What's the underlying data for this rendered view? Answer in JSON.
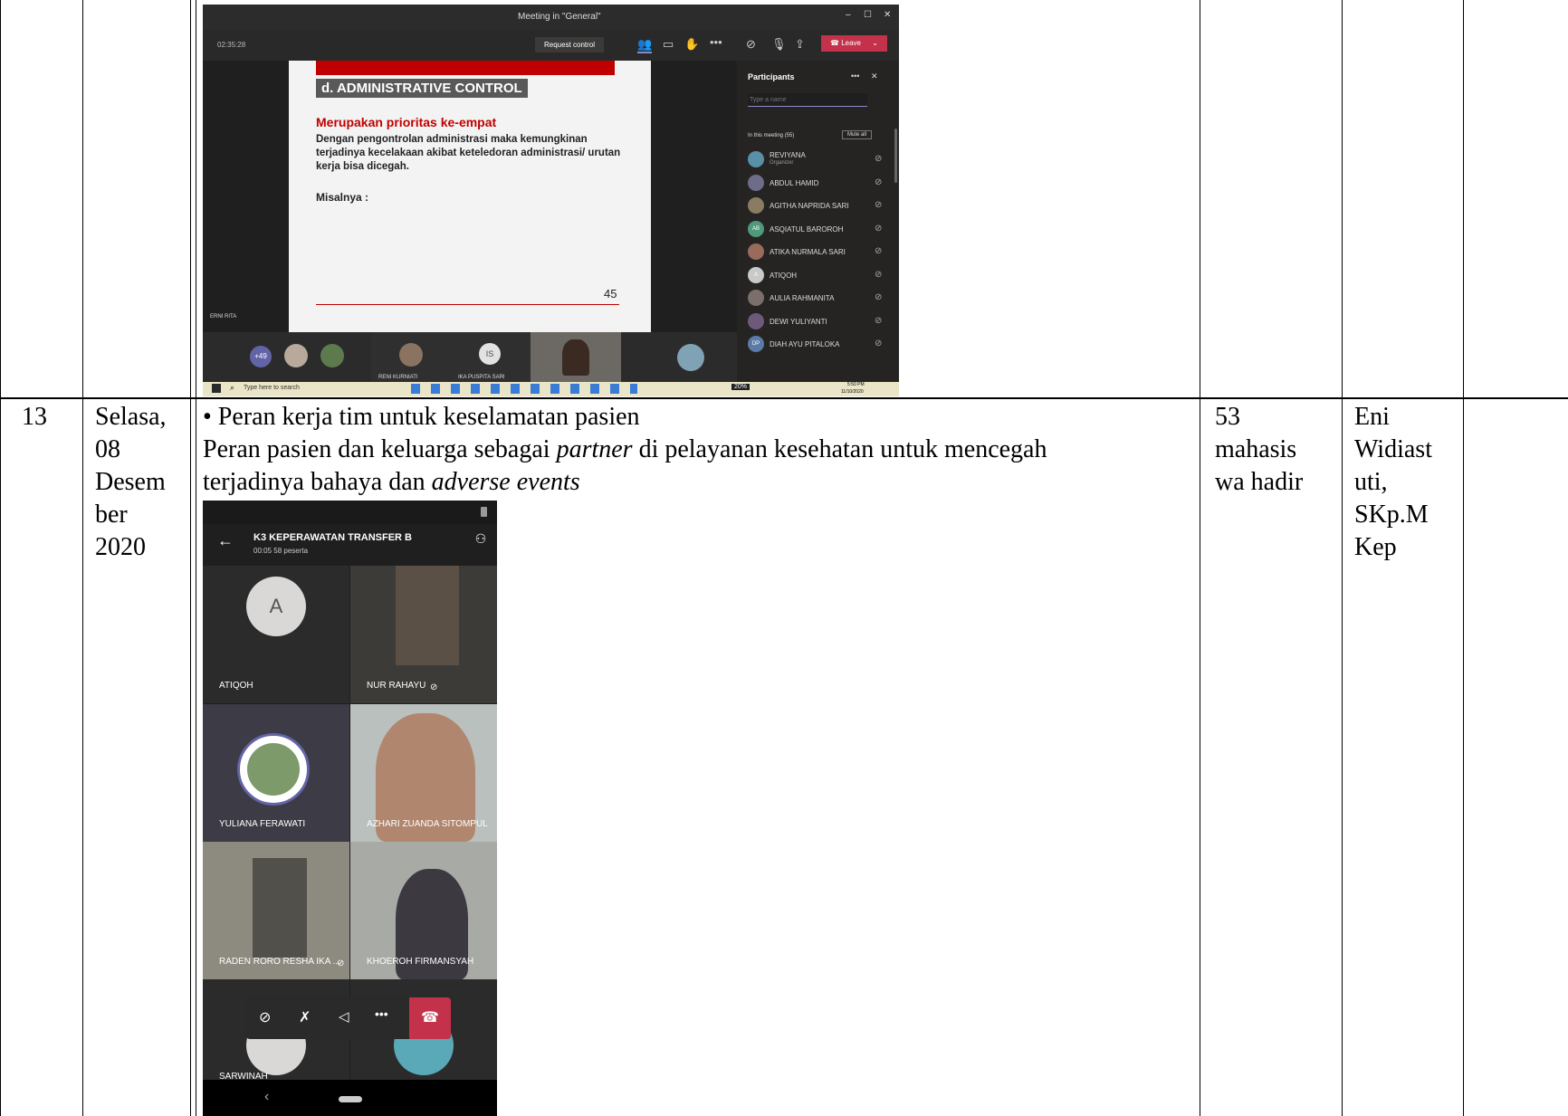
{
  "row_top": {
    "teams": {
      "window_title": "Meeting in \"General\"",
      "timer": "02:35:28",
      "request_control": "Request control",
      "leave": "Leave",
      "slide": {
        "heading": "d. ADMINISTRATIVE CONTROL",
        "subheading": "Merupakan prioritas ke-empat",
        "body": "Dengan pengontrolan administrasi maka kemungkinan terjadinya kecelakaan akibat keteledoran administrasi/ urutan kerja bisa dicegah.",
        "misalnya": "Misalnya :",
        "page_number": "45"
      },
      "presenter": "ERNI RITA",
      "participants": {
        "title": "Participants",
        "search_placeholder": "Type a name",
        "in_meeting": "In this meeting (55)",
        "mute_all": "Mute all",
        "list": [
          {
            "name": "REVIYANA",
            "role": "Organizer",
            "initials": ""
          },
          {
            "name": "ABDUL HAMID",
            "role": "",
            "initials": ""
          },
          {
            "name": "AGITHA NAPRIDA SARI",
            "role": "",
            "initials": ""
          },
          {
            "name": "ASQIATUL BAROROH",
            "role": "",
            "initials": "AB"
          },
          {
            "name": "ATIKA NURMALA SARI",
            "role": "",
            "initials": ""
          },
          {
            "name": "ATIQOH",
            "role": "",
            "initials": "A"
          },
          {
            "name": "AULIA RAHMANITA",
            "role": "",
            "initials": ""
          },
          {
            "name": "DEWI YULIYANTI",
            "role": "",
            "initials": ""
          },
          {
            "name": "DIAH AYU PITALOKA",
            "role": "",
            "initials": "DP"
          }
        ]
      },
      "strip": {
        "more_count": "+49",
        "names": [
          "RENI KURNIATI",
          "IKA PUSPITA SARI",
          "IS"
        ]
      },
      "taskbar": {
        "search": "Type here to search",
        "time": "5:50 PM",
        "date": "11/10/2020",
        "battery": "20%"
      }
    }
  },
  "row_13": {
    "no": "13",
    "day": "Selasa,",
    "date_lines": [
      "08",
      "Desem",
      "ber",
      "2020"
    ],
    "topic_line1": "• Peran kerja tim untuk keselamatan pasien",
    "topic_line2a": "Peran pasien dan  keluarga sebagai ",
    "topic_line2_em": "partner",
    "topic_line2b": " di pelayanan kesehatan untuk mencegah",
    "topic_line3a": "terjadinya bahaya dan ",
    "topic_line3_em": "adverse events",
    "attendance_lines": [
      "53",
      "mahasis",
      "wa hadir"
    ],
    "lecturer_lines": [
      "Eni",
      "Widiast",
      "uti,",
      "SKp.M",
      "Kep"
    ],
    "mobile": {
      "title": "K3 KEPERAWATAN TRANSFER B",
      "subtitle": "00:05  58 peserta",
      "tiles": [
        "ATIQOH",
        "NUR RAHAYU",
        "YULIANA FERAWATI",
        "AZHARI ZUANDA SITOMPUL",
        "RADEN RORO RESHA IKA ...",
        "KHOEROH FIRMANSYAH",
        "SARWINAH"
      ],
      "avatar_letter": "A"
    }
  }
}
